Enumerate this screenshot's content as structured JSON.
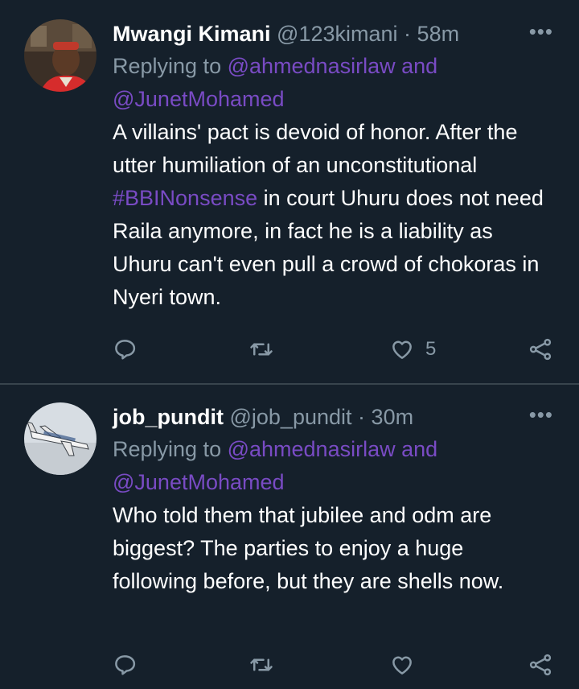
{
  "tweets": [
    {
      "display_name": "Mwangi Kimani",
      "handle": "@123kimani",
      "separator": "·",
      "time": "58m",
      "more_icon": "more-horizontal-icon",
      "replying_prefix": "Replying to ",
      "mention_1": "@ahmednasirlaw",
      "replying_and": " and",
      "mention_2": "@JunetMohamed",
      "text_part_1": "A villains' pact is devoid of honor. After the utter humiliation of an unconstitutional ",
      "hashtag": "#BBINonsense",
      "text_part_2": " in court Uhuru does not need Raila anymore, in fact he is a liability as Uhuru can't even pull a crowd of chokoras in Nyeri town.",
      "like_count": "5"
    },
    {
      "display_name": "job_pundit",
      "handle": "@job_pundit",
      "separator": "·",
      "time": "30m",
      "more_icon": "more-horizontal-icon",
      "replying_prefix": "Replying to ",
      "mention_1": "@ahmednasirlaw",
      "replying_and": " and",
      "mention_2": "@JunetMohamed",
      "text": "Who told them that jubilee and odm are biggest? The parties to enjoy a huge following before, but they are shells now.",
      "like_count": ""
    }
  ],
  "colors": {
    "background": "#15202b",
    "secondary_text": "#8899a6",
    "link": "#794bc4",
    "divider": "#38444d"
  },
  "icons": [
    "reply-icon",
    "retweet-icon",
    "like-icon",
    "share-icon",
    "more-horizontal-icon"
  ]
}
